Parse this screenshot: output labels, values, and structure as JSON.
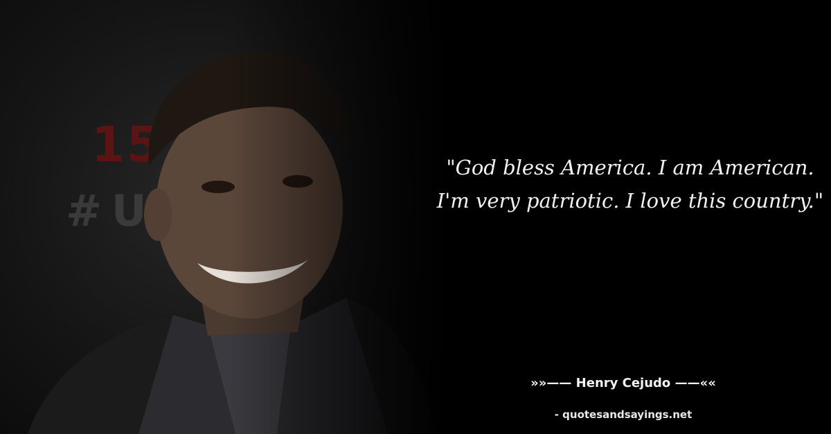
{
  "photo": {
    "backdrop_number": "15",
    "backdrop_hashtag": "#UF"
  },
  "quote": {
    "text": "\"God bless America. I am American. I'm very patriotic. I love this country.\""
  },
  "author": {
    "line": "»»—— Henry Cejudo ——««"
  },
  "source": {
    "line": "- quotesandsayings.net"
  },
  "colors": {
    "background": "#000000",
    "text": "#f2f2f2"
  }
}
